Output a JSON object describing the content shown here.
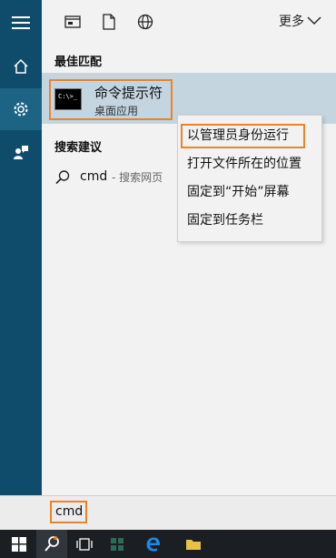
{
  "toolbar": {
    "more_label": "更多"
  },
  "best_match": {
    "heading": "最佳匹配",
    "title": "命令提示符",
    "subtitle": "桌面应用",
    "icon_text": "C:\\>_"
  },
  "suggestions": {
    "heading": "搜索建议",
    "term": "cmd",
    "separator": "- 搜索网页"
  },
  "context_menu": {
    "items": [
      "以管理员身份运行",
      "打开文件所在的位置",
      "固定到“开始”屏幕",
      "固定到任务栏"
    ]
  },
  "search": {
    "value": "cmd"
  },
  "colors": {
    "rail": "#0f4c6b",
    "highlight_border": "#e8842c",
    "best_match_bg": "#c5d5e0",
    "taskbar": "#1b1f24"
  }
}
